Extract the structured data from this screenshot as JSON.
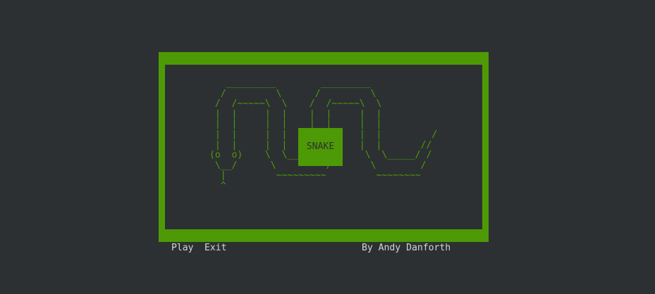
{
  "colors": {
    "background": "#2c3033",
    "accent_green": "#4e9a06",
    "menu_text": "#d3d7cf"
  },
  "title": "SNAKE",
  "ascii_art": "   _________        _________\n  /         \\      /         \\\n /  /~~~~~\\  \\    /  /~~~~~\\  \\\n |  |     |  |    |  |     |  |\n |  |     |  |    |  |     |  |\n |  |     |  |    |  |     |  |         /\n |  |     |  |    |  |     |  |       //\n(o  o)    \\  \\_____/  /     \\  \\_____/ /\n \\__/      \\         /       \\        /\n  |         ~~~~~~~~~         ~~~~~~~~\n  ^",
  "menu": {
    "play_label": "Play",
    "exit_label": "Exit"
  },
  "credit": "By Andy Danforth"
}
